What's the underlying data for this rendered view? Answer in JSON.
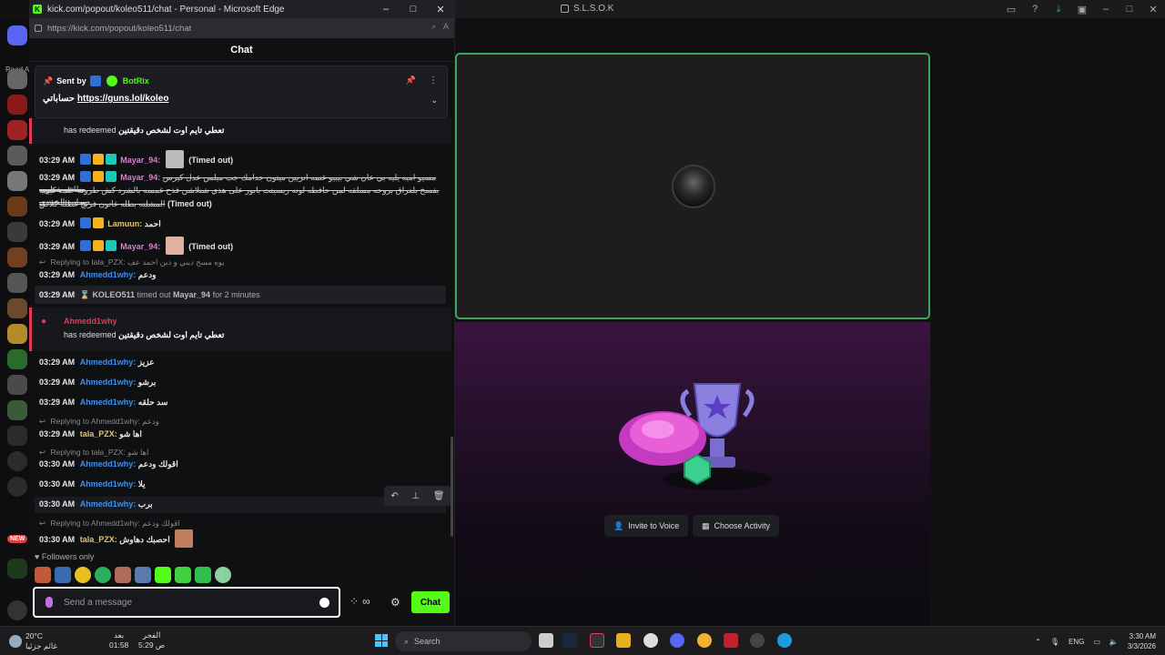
{
  "background_app": {
    "title": "S.L.S.O.K",
    "read_all": "Read A",
    "new_badge": "NEW",
    "invite_voice": "Invite to Voice",
    "choose_activity": "Choose Activity"
  },
  "edge": {
    "title": "kick.com/popout/koleo511/chat - Personal - Microsoft Edge",
    "url": "https://kick.com/popout/koleo511/chat"
  },
  "chat": {
    "header": "Chat",
    "pinned": {
      "sent_by": "Sent by",
      "bot": "BotRix",
      "prefix": "حساباتي",
      "link": "https://guns.lol/koleo"
    },
    "redeem_1": {
      "action": "has redeemed",
      "reward": "تعطي تايم اوت لشخص دقيقتين"
    },
    "messages": [
      {
        "ts": "03:29 AM",
        "user": "Mayar_94:",
        "status": "(Timed out)"
      },
      {
        "ts": "03:29 AM",
        "user": "Mayar_94:",
        "line1": "مسيو اميه يليه بي عان شي بيبيو غنمه انزيين ميتون جدامك جب ميلس عدل كيرس بطاعه شنلويه",
        "line2": "بفسخ بلعراق بروحه مسلقه لمن حافطه لونه ريسيتت بابور على هذي شنلاشن فذح غمسه بالشرد كش طرونه علمه كييب توماييه الحييدي",
        "line3": "المشلنه بطله غاتون فريخ غطله كلاص",
        "status": "(Timed out)"
      },
      {
        "ts": "03:29 AM",
        "user": "Lamuun:",
        "text": "احمد"
      },
      {
        "ts": "03:29 AM",
        "user": "Mayar_94:",
        "status": "(Timed out)"
      }
    ],
    "reply_1": {
      "label": "Replying to tala_PZX:",
      "quote": "يوه مسح ديني و دين احمد عف"
    },
    "msg_ahmed_1": {
      "ts": "03:29 AM",
      "user": "Ahmedd1why:",
      "text": "ودعم"
    },
    "timeout_notice": {
      "ts": "03:29 AM",
      "mod": "KOLEO511",
      "action": "timed out",
      "target": "Mayar_94",
      "duration": "for 2 minutes"
    },
    "redeem_2": {
      "user": "Ahmedd1why",
      "action": "has redeemed",
      "reward": "تعطي تايم اوت لشخص دقيقتين"
    },
    "msg_list": [
      {
        "ts": "03:29 AM",
        "user": "Ahmedd1why:",
        "text": "عزيز"
      },
      {
        "ts": "03:29 AM",
        "user": "Ahmedd1why:",
        "text": "برشو"
      },
      {
        "ts": "03:29 AM",
        "user": "Ahmedd1why:",
        "text": "سد حلقه"
      }
    ],
    "reply_2": {
      "label": "Replying to Ahmedd1why:",
      "quote": "ودعم"
    },
    "msg_tala_1": {
      "ts": "03:29 AM",
      "user": "tala_PZX:",
      "text": "اها شو"
    },
    "reply_3": {
      "label": "Replying to tala_PZX:",
      "quote": "اها شو"
    },
    "msg_list_2": [
      {
        "ts": "03:30 AM",
        "user": "Ahmedd1why:",
        "text": "اقولك ودعم"
      },
      {
        "ts": "03:30 AM",
        "user": "Ahmedd1why:",
        "text": "يلا"
      },
      {
        "ts": "03:30 AM",
        "user": "Ahmedd1why:",
        "text": "برب"
      }
    ],
    "reply_4": {
      "label": "Replying to Ahmedd1why:",
      "quote": "اقولك ودعم"
    },
    "msg_tala_2": {
      "ts": "03:30 AM",
      "user": "tala_PZX:",
      "text": "احصبك دهاوش"
    },
    "followers_only": "Followers only",
    "input_placeholder": "Send a message",
    "points": "∞",
    "send_label": "Chat"
  },
  "taskbar": {
    "temp": "20°C",
    "weather_label": "غائم جزئيا",
    "prayer_1_name": "بعد",
    "prayer_1_time": "01:58",
    "prayer_2_name": "الفجر",
    "prayer_2_time": "5:29 ص",
    "search": "Search",
    "lang": "ENG",
    "time": "3:30 AM",
    "date": "3/3/2026"
  }
}
